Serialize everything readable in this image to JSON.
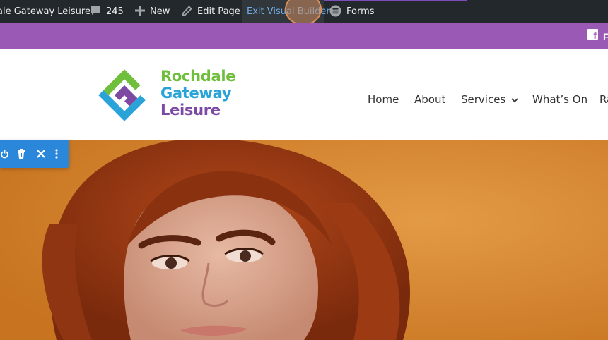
{
  "admin_bar": {
    "site_name": "ale Gateway Leisure",
    "comments_count": "245",
    "new_label": "New",
    "edit_page_label": "Edit Page",
    "exit_builder_label": "Exit Visual Builder",
    "forms_label": "Forms"
  },
  "top_bar": {
    "facebook_text": "F",
    "facebook_icon": "facebook-icon"
  },
  "logo": {
    "line1": "Rochdale",
    "line2": "Gateway",
    "line3": "Leisure",
    "colors": {
      "green": "#6fbe3c",
      "blue": "#2aa4d8",
      "purple": "#7d4aa3"
    }
  },
  "nav": {
    "items": [
      {
        "label": "Home"
      },
      {
        "label": "About"
      },
      {
        "label": "Services"
      },
      {
        "label": "What’s On"
      },
      {
        "label": "Ra"
      }
    ]
  },
  "builder_toolbar": {
    "icons": [
      "power-icon",
      "trash-icon",
      "close-icon",
      "more-vertical-icon"
    ]
  },
  "colors": {
    "admin_bar_bg": "#23282d",
    "top_bar_bg": "#9b59b6",
    "builder_blue": "#2b87da",
    "hero_orange": "#d4822a"
  }
}
